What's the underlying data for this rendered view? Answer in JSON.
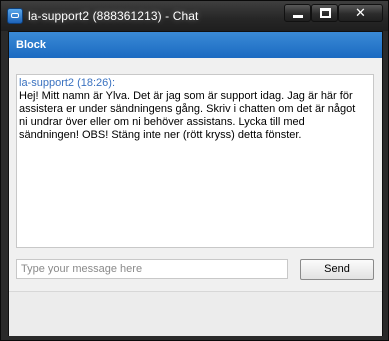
{
  "window": {
    "title": "la-support2 (888361213) - Chat",
    "app_icon": "teamviewer-icon",
    "controls": {
      "minimize_icon": "minimize-icon",
      "maximize_icon": "maximize-icon",
      "close_icon": "close-icon",
      "close_glyph": "✕"
    }
  },
  "toolbar": {
    "block_label": "Block",
    "accent_color": "#2a7acc"
  },
  "chat": {
    "messages": [
      {
        "sender": "la-support2 (18:26):",
        "text": "Hej! Mitt namn är Ylva. Det är jag som är support idag. Jag är här för assistera er under sändningens gång. Skriv i chatten om det är något ni undrar över eller om ni behöver assistans. Lycka till med sändningen! OBS! Stäng inte ner (rött kryss) detta fönster."
      }
    ]
  },
  "composer": {
    "placeholder": "Type your message here",
    "value": "",
    "send_label": "Send"
  }
}
